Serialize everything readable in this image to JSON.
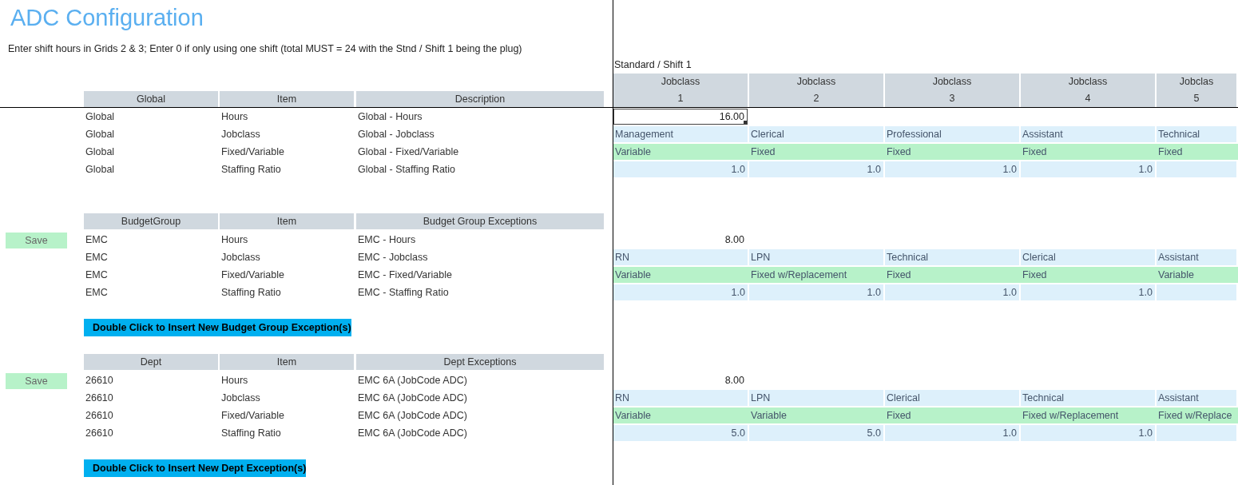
{
  "title": "ADC Configuration",
  "instruction": "Enter shift hours in Grids 2 & 3; Enter 0 if only using one shift (total MUST = 24 with the Stnd / Shift 1 being the plug)",
  "grid": {
    "title": "Standard / Shift 1",
    "columns": [
      {
        "label": "Jobclass",
        "number": "1"
      },
      {
        "label": "Jobclass",
        "number": "2"
      },
      {
        "label": "Jobclass",
        "number": "3"
      },
      {
        "label": "Jobclass",
        "number": "4"
      },
      {
        "label": "Jobclas",
        "number": "5"
      }
    ]
  },
  "sections": [
    {
      "headers": [
        "Global",
        "Item",
        "Description"
      ],
      "rows": [
        {
          "group": "Global",
          "item": "Hours",
          "description": "Global - Hours",
          "kind": "hours",
          "cell_selected": true,
          "values": [
            "16.00"
          ]
        },
        {
          "group": "Global",
          "item": "Jobclass",
          "description": "Global - Jobclass",
          "kind": "jobclass",
          "values": [
            "Management",
            "Clerical",
            "Professional",
            "Assistant",
            "Technical"
          ]
        },
        {
          "group": "Global",
          "item": "Fixed/Variable",
          "description": "Global - Fixed/Variable",
          "kind": "fixed_variable",
          "values": [
            "Variable",
            "Fixed",
            "Fixed",
            "Fixed",
            "Fixed"
          ]
        },
        {
          "group": "Global",
          "item": "Staffing Ratio",
          "description": "Global - Staffing Ratio",
          "kind": "ratio",
          "values": [
            "1.0",
            "1.0",
            "1.0",
            "1.0"
          ]
        }
      ]
    },
    {
      "headers": [
        "BudgetGroup",
        "Item",
        "Budget Group Exceptions"
      ],
      "save_button": "Save",
      "insert_button": "Double Click to Insert New Budget Group Exception(s)",
      "rows": [
        {
          "group": "EMC",
          "item": "Hours",
          "description": "EMC - Hours",
          "kind": "hours",
          "cell_selected": false,
          "values": [
            "8.00"
          ]
        },
        {
          "group": "EMC",
          "item": "Jobclass",
          "description": "EMC - Jobclass",
          "kind": "jobclass",
          "values": [
            "RN",
            "LPN",
            "Technical",
            "Clerical",
            "Assistant"
          ]
        },
        {
          "group": "EMC",
          "item": "Fixed/Variable",
          "description": "EMC - Fixed/Variable",
          "kind": "fixed_variable",
          "values": [
            "Variable",
            "Fixed w/Replacement",
            "Fixed",
            "Fixed",
            "Variable"
          ]
        },
        {
          "group": "EMC",
          "item": "Staffing Ratio",
          "description": "EMC - Staffing Ratio",
          "kind": "ratio",
          "values": [
            "1.0",
            "1.0",
            "1.0",
            "1.0"
          ]
        }
      ]
    },
    {
      "headers": [
        "Dept",
        "Item",
        "Dept Exceptions"
      ],
      "save_button": "Save",
      "insert_button": "Double Click to Insert New Dept Exception(s)",
      "rows": [
        {
          "group": "26610",
          "item": "Hours",
          "description": "EMC 6A (JobCode ADC)",
          "kind": "hours",
          "cell_selected": false,
          "values": [
            "8.00"
          ]
        },
        {
          "group": "26610",
          "item": "Jobclass",
          "description": "EMC 6A (JobCode ADC)",
          "kind": "jobclass",
          "values": [
            "RN",
            "LPN",
            "Clerical",
            "Technical",
            "Assistant"
          ]
        },
        {
          "group": "26610",
          "item": "Fixed/Variable",
          "description": "EMC 6A (JobCode ADC)",
          "kind": "fixed_variable",
          "values": [
            "Variable",
            "Variable",
            "Fixed",
            "Fixed w/Replacement",
            "Fixed w/Replace"
          ]
        },
        {
          "group": "26610",
          "item": "Staffing Ratio",
          "description": "EMC 6A (JobCode ADC)",
          "kind": "ratio",
          "values": [
            "5.0",
            "5.0",
            "1.0",
            "1.0"
          ]
        }
      ]
    }
  ]
}
